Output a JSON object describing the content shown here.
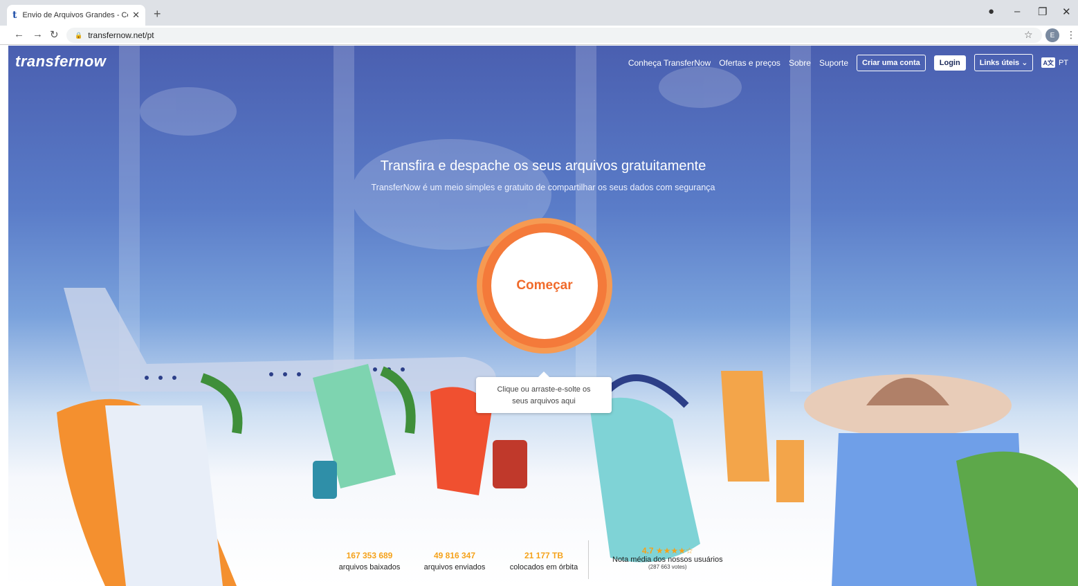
{
  "browser": {
    "tab_title": "Envio de Arquivos Grandes - Con",
    "tab_favicon": "t",
    "tab_close": "✕",
    "new_tab": "+",
    "url": "transfernow.net/pt",
    "profile_initial": "E"
  },
  "header": {
    "logo": "transfernow",
    "nav": [
      "Conheça TransferNow",
      "Ofertas e preços",
      "Sobre",
      "Suporte"
    ],
    "signup_label": "Criar uma conta",
    "login_label": "Login",
    "links_label": "Links úteis",
    "lang_icon": "A文",
    "lang_label": "PT"
  },
  "hero": {
    "title": "Transfira e despache os seus arquivos gratuitamente",
    "subtitle": "TransferNow é um meio simples e gratuito de compartilhar os seus dados com segurança",
    "start_label": "Começar",
    "tooltip_line1": "Clique ou arraste-e-solte os",
    "tooltip_line2": "seus arquivos aqui"
  },
  "stats": {
    "downloaded_num": "167 353 689",
    "downloaded_label": "arquivos baixados",
    "sent_num": "49 816 347",
    "sent_label": "arquivos enviados",
    "orbit_num": "21 177 TB",
    "orbit_label": "colocados em órbita",
    "rating_num": "4.7 ★★★★☆",
    "rating_label": "Nota média dos nossos usuários",
    "rating_votes": "(287 663 votes)"
  },
  "colors": {
    "accent": "#f47a3a",
    "stat_number": "#f5a21a",
    "header_bg": "#4a5fb0"
  }
}
